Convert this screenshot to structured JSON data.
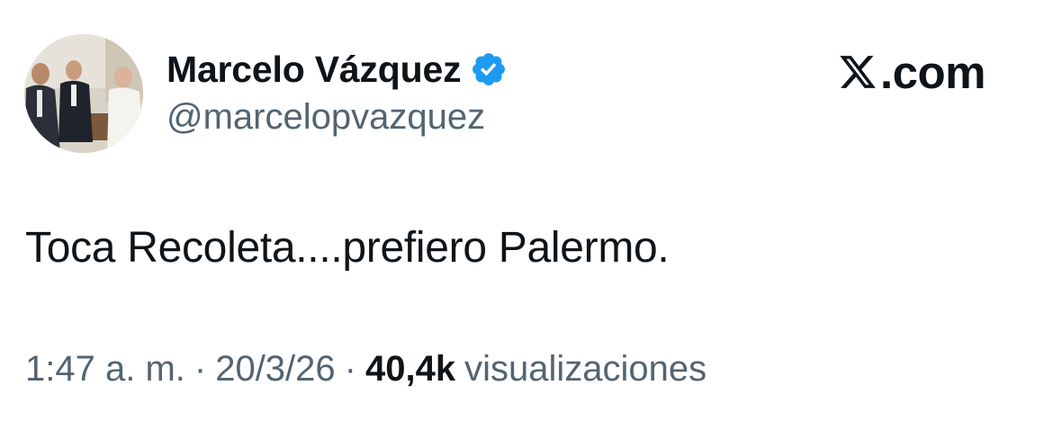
{
  "author": {
    "display_name": "Marcelo Vázquez",
    "handle": "@marcelopvazquez",
    "verified": true,
    "verified_color": "#1d9bf0"
  },
  "brand": {
    "icon": "x-logo-icon",
    "suffix": ".com"
  },
  "tweet": {
    "text": "Toca Recoleta....prefiero Palermo."
  },
  "meta": {
    "time": "1:47 a. m.",
    "separator": "·",
    "date": "20/3/26",
    "views_count": "40,4k",
    "views_label": "visualizaciones"
  },
  "colors": {
    "primary_text": "#0f1419",
    "secondary_text": "#536471",
    "background": "#ffffff"
  }
}
